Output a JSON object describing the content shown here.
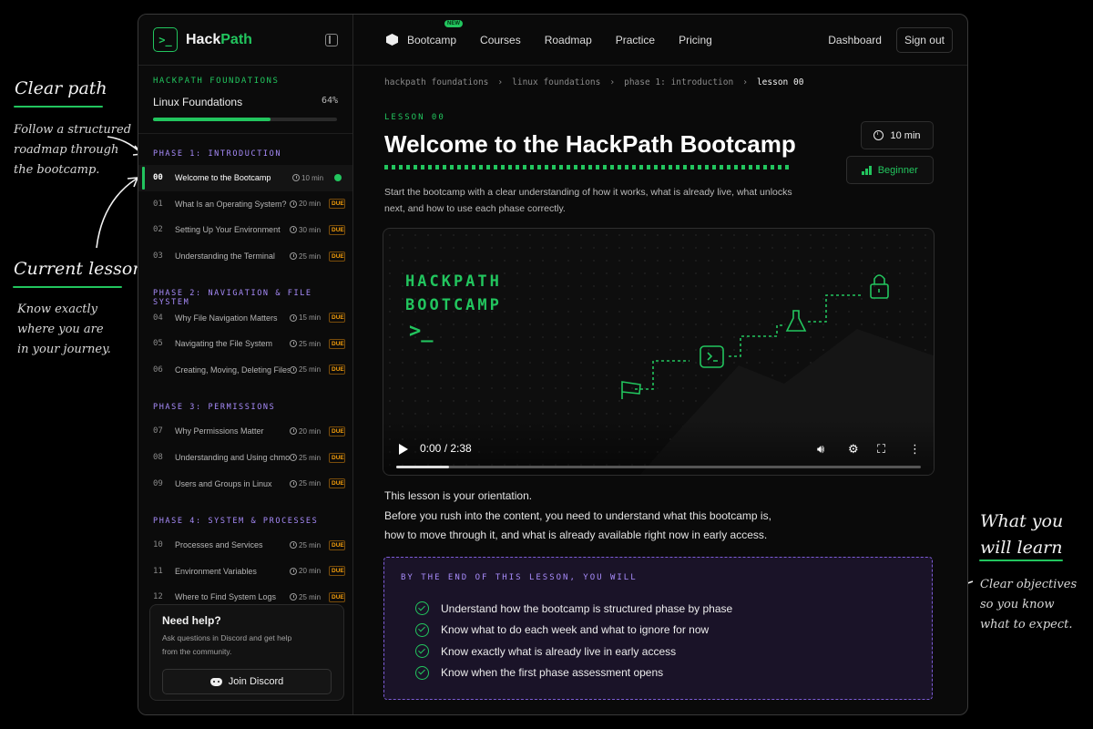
{
  "annotations": {
    "clear_path": {
      "title": "Clear path",
      "text": "Follow a structured roadmap through the bootcamp."
    },
    "current_lesson": {
      "title": "Current lesson",
      "text": "Know exactly where you are in your journey."
    },
    "what_you_learn": {
      "title": "What you will learn",
      "text": "Clear objectives so you know what to expect."
    }
  },
  "brand": {
    "name_a": "Hack",
    "name_b": "Path",
    "logo_glyph": ">_"
  },
  "course": {
    "eyebrow": "HACKPATH FOUNDATIONS",
    "name": "Linux Foundations",
    "progress_label": "64%",
    "progress": 0.64
  },
  "phases": [
    {
      "title": "PHASE 1: INTRODUCTION",
      "lessons": [
        {
          "num": "00",
          "title": "Welcome to the Bootcamp",
          "time": "10 min",
          "active": true
        },
        {
          "num": "01",
          "title": "What Is an Operating System?",
          "time": "20 min",
          "due": "DUE"
        },
        {
          "num": "02",
          "title": "Setting Up Your Environment",
          "time": "30 min",
          "due": "DUE"
        },
        {
          "num": "03",
          "title": "Understanding the Terminal",
          "time": "25 min",
          "due": "DUE"
        }
      ]
    },
    {
      "title": "PHASE 2: NAVIGATION & FILE SYSTEM",
      "lessons": [
        {
          "num": "04",
          "title": "Why File Navigation Matters",
          "time": "15 min",
          "due": "DUE"
        },
        {
          "num": "05",
          "title": "Navigating the File System",
          "time": "25 min",
          "due": "DUE"
        },
        {
          "num": "06",
          "title": "Creating, Moving, Deleting Files",
          "time": "25 min",
          "due": "DUE"
        }
      ]
    },
    {
      "title": "PHASE 3: PERMISSIONS",
      "lessons": [
        {
          "num": "07",
          "title": "Why Permissions Matter",
          "time": "20 min",
          "due": "DUE"
        },
        {
          "num": "08",
          "title": "Understanding and Using chmod",
          "time": "25 min",
          "due": "DUE"
        },
        {
          "num": "09",
          "title": "Users and Groups in Linux",
          "time": "25 min",
          "due": "DUE"
        }
      ]
    },
    {
      "title": "PHASE 4: SYSTEM & PROCESSES",
      "lessons": [
        {
          "num": "10",
          "title": "Processes and Services",
          "time": "25 min",
          "due": "DUE"
        },
        {
          "num": "11",
          "title": "Environment Variables",
          "time": "20 min",
          "due": "DUE"
        },
        {
          "num": "12",
          "title": "Where to Find System Logs",
          "time": "25 min",
          "due": "DUE"
        }
      ]
    }
  ],
  "help": {
    "title": "Need help?",
    "text": "Ask questions in Discord and get help from the community.",
    "button": "Join Discord"
  },
  "nav": {
    "items": [
      "Bootcamp",
      "Courses",
      "Roadmap",
      "Practice",
      "Pricing"
    ],
    "new_badge": "NEW",
    "dashboard": "Dashboard",
    "signout": "Sign out"
  },
  "breadcrumb": [
    "hackpath foundations",
    "linux foundations",
    "phase 1: introduction",
    "lesson 00"
  ],
  "lesson": {
    "eyebrow": "LESSON 00",
    "title": "Welcome to the HackPath Bootcamp",
    "duration": "10 min",
    "level": "Beginner",
    "intro": "Start the bootcamp with a clear understanding of how it works, what is already live, what unlocks next, and how to use each phase correctly."
  },
  "video": {
    "title_line1": "HACKPATH",
    "title_line2": "BOOTCAMP",
    "prompt": ">_",
    "time": "0:00 / 2:38",
    "played": 0.1
  },
  "body": {
    "p1": "This lesson is your orientation.",
    "p2": "Before you rush into the content, you need to understand what this bootcamp is, how to move through it, and what is already available right now in early access."
  },
  "objectives": {
    "eyebrow": "BY THE END OF THIS LESSON, YOU WILL",
    "items": [
      "Understand how the bootcamp is structured phase by phase",
      "Know what to do each week and what to ignore for now",
      "Know exactly what is already live in early access",
      "Know when the first phase assessment opens"
    ]
  },
  "colors": {
    "accent": "#22c55e",
    "purple": "#a78bfa",
    "due": "#f59e0b"
  }
}
